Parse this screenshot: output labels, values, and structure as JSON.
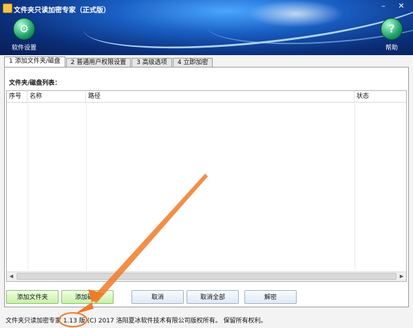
{
  "window": {
    "title": "文件夹只读加密专家（正式版）"
  },
  "toolbar": {
    "settings_label": "软件设置",
    "settings_icon": "gear-icon",
    "help_label": "帮助",
    "help_icon": "help-icon"
  },
  "tabs": [
    {
      "label": "1 添加文件夹/磁盘",
      "active": true
    },
    {
      "label": "2 普通用户权限设置",
      "active": false
    },
    {
      "label": "3 高级选项",
      "active": false
    },
    {
      "label": "4 立即加密",
      "active": false
    }
  ],
  "list": {
    "label": "文件夹/磁盘列表：",
    "columns": [
      "序号",
      "名称",
      "路径",
      "状态"
    ]
  },
  "buttons": {
    "add_folder": "添加文件夹",
    "add_disk": "添加磁盘",
    "cancel": "取消",
    "cancel_all": "取消全部",
    "decrypt": "解密"
  },
  "status": {
    "product": "文件夹只读加密专家",
    "version": "1.13 版",
    "copyright": "(C) 2017 洛阳夏冰软件技术有限公司版权所有。 保留所有权利。"
  },
  "colors": {
    "header_dark": "#0b2f7a",
    "header_light": "#4aa6ff",
    "annotation": "#f07a28"
  }
}
